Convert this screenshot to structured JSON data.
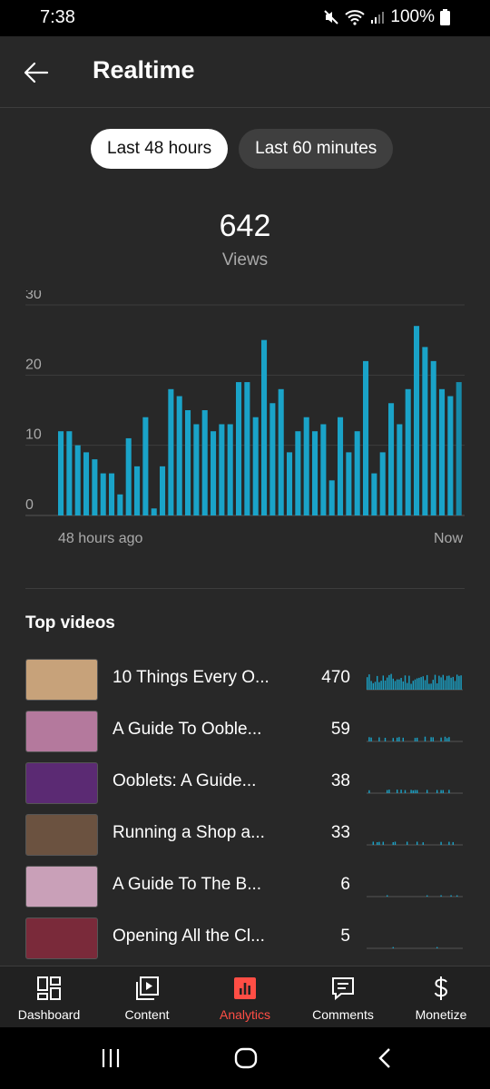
{
  "status": {
    "time": "7:38",
    "battery": "100%"
  },
  "header": {
    "title": "Realtime"
  },
  "tabs": [
    {
      "label": "Last 48 hours",
      "active": true
    },
    {
      "label": "Last 60 minutes",
      "active": false
    }
  ],
  "summary": {
    "total": "642",
    "label": "Views"
  },
  "chart_data": {
    "type": "bar",
    "y_ticks": [
      "0",
      "10",
      "20",
      "30"
    ],
    "ylim": [
      0,
      30
    ],
    "x_start_label": "48 hours ago",
    "x_end_label": "Now",
    "values": [
      12,
      12,
      10,
      9,
      8,
      6,
      6,
      3,
      11,
      7,
      14,
      1,
      7,
      18,
      17,
      15,
      13,
      15,
      12,
      13,
      13,
      19,
      19,
      14,
      25,
      16,
      18,
      9,
      12,
      14,
      12,
      13,
      5,
      14,
      9,
      12,
      22,
      6,
      9,
      16,
      13,
      18,
      27,
      24,
      22,
      18,
      17,
      19
    ],
    "bar_color": "#1aa3c8"
  },
  "top_videos": {
    "title": "Top videos",
    "items": [
      {
        "title": "10 Things Every O...",
        "views": "470",
        "thumb_color": "#c7a27a"
      },
      {
        "title": "A Guide To Ooble...",
        "views": "59",
        "thumb_color": "#b4799d"
      },
      {
        "title": "Ooblets: A Guide...",
        "views": "38",
        "thumb_color": "#5b2a73"
      },
      {
        "title": "Running a Shop a...",
        "views": "33",
        "thumb_color": "#6b5240"
      },
      {
        "title": "A Guide To The B...",
        "views": "6",
        "thumb_color": "#c9a0b8"
      },
      {
        "title": "Opening All the Cl...",
        "views": "5",
        "thumb_color": "#7a2a3a"
      }
    ]
  },
  "nav": [
    {
      "label": "Dashboard",
      "icon": "dashboard-icon",
      "active": false
    },
    {
      "label": "Content",
      "icon": "content-icon",
      "active": false
    },
    {
      "label": "Analytics",
      "icon": "analytics-icon",
      "active": true
    },
    {
      "label": "Comments",
      "icon": "comments-icon",
      "active": false
    },
    {
      "label": "Monetize",
      "icon": "monetize-icon",
      "active": false
    }
  ]
}
